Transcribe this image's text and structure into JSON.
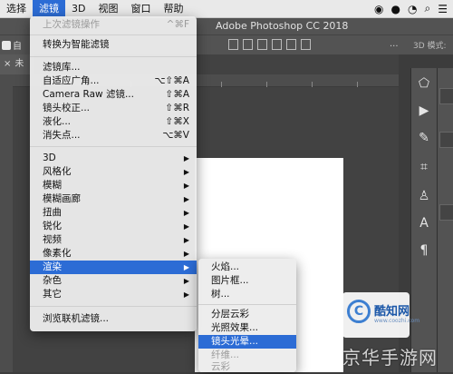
{
  "menubar": {
    "items": [
      "选择",
      "滤镜",
      "3D",
      "视图",
      "窗口",
      "帮助"
    ],
    "active_index": 1,
    "status_icons": [
      "wechat-icon",
      "qq-icon",
      "bell-icon",
      "search-icon",
      "list-icon"
    ]
  },
  "app": {
    "title": "Adobe Photoshop CC 2018",
    "options_label": "自",
    "mode_3d": "3D 模式:",
    "options_more": "...",
    "tab_close": "×",
    "tab_label": "未"
  },
  "filter_menu": {
    "last_filter": {
      "label": "上次滤镜操作",
      "shortcut": "^⌘F"
    },
    "convert": "转换为智能滤镜",
    "group1": [
      {
        "label": "滤镜库...",
        "shortcut": ""
      },
      {
        "label": "自适应广角...",
        "shortcut": "⌥⇧⌘A"
      },
      {
        "label": "Camera Raw 滤镜...",
        "shortcut": "⇧⌘A"
      },
      {
        "label": "镜头校正...",
        "shortcut": "⇧⌘R"
      },
      {
        "label": "液化...",
        "shortcut": "⇧⌘X"
      },
      {
        "label": "消失点...",
        "shortcut": "⌥⌘V"
      }
    ],
    "submenus": [
      "3D",
      "风格化",
      "模糊",
      "模糊画廊",
      "扭曲",
      "锐化",
      "视频",
      "像素化",
      "渲染",
      "杂色",
      "其它"
    ],
    "highlight": "渲染",
    "browse": "浏览联机滤镜...",
    "arrow": "▶"
  },
  "render_submenu": {
    "items": [
      "火焰...",
      "图片框...",
      "树...",
      "分层云彩",
      "光照效果...",
      "镜头光晕...",
      "纤维...",
      "云彩"
    ],
    "highlight": "镜头光晕..."
  },
  "watermark": {
    "logo_name": "酷知网",
    "logo_url": "www.coozhi.com",
    "logo_mark": "C",
    "overlay": "京华手游网"
  }
}
